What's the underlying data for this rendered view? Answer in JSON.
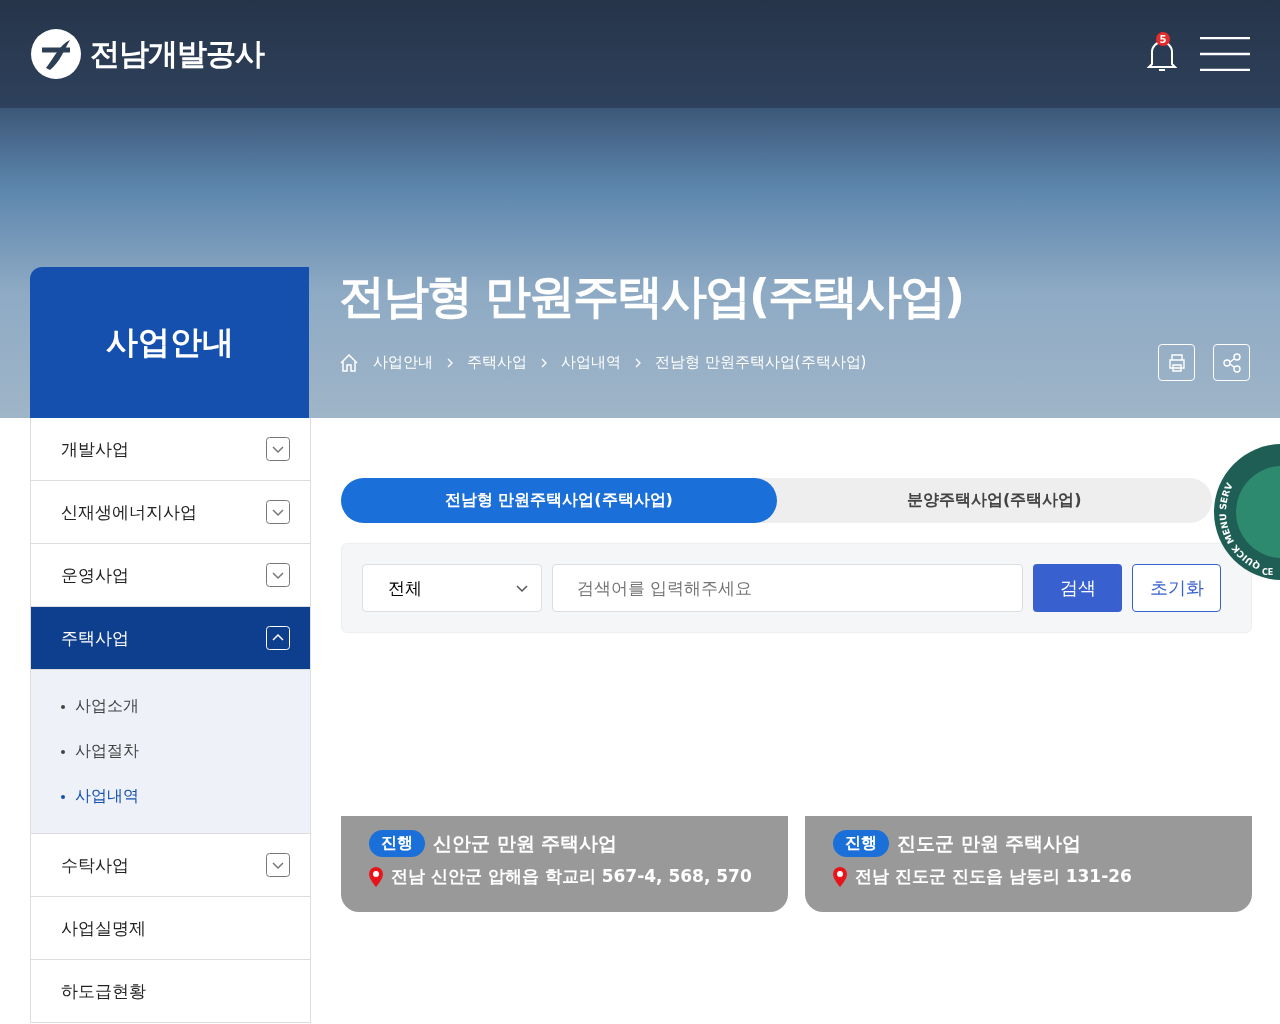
{
  "header": {
    "logo_text": "전남개발공사",
    "notification_count": "5"
  },
  "hero": {
    "title": "전남형 만원주택사업(주택사업)",
    "breadcrumb": [
      "사업안내",
      "주택사업",
      "사업내역",
      "전남형 만원주택사업(주택사업)"
    ]
  },
  "sidebar": {
    "title": "사업안내",
    "items": [
      {
        "label": "개발사업",
        "expanded": false,
        "selected": false
      },
      {
        "label": "신재생에너지사업",
        "expanded": false,
        "selected": false
      },
      {
        "label": "운영사업",
        "expanded": false,
        "selected": false
      },
      {
        "label": "주택사업",
        "expanded": true,
        "selected": true,
        "children": [
          {
            "label": "사업소개",
            "selected": false
          },
          {
            "label": "사업절차",
            "selected": false
          },
          {
            "label": "사업내역",
            "selected": true
          }
        ]
      },
      {
        "label": "수탁사업",
        "expanded": false,
        "selected": false
      },
      {
        "label": "사업실명제",
        "selected": false
      },
      {
        "label": "하도급현황",
        "selected": false
      }
    ]
  },
  "tabs": [
    {
      "label": "전남형 만원주택사업(주택사업)",
      "selected": true
    },
    {
      "label": "분양주택사업(주택사업)",
      "selected": false
    }
  ],
  "search": {
    "category": "전체",
    "placeholder": "검색어를 입력해주세요",
    "search_button": "검색",
    "reset_button": "초기화"
  },
  "projects": [
    {
      "status": "진행",
      "title": "신안군 만원 주택사업",
      "address": "전남 신안군 압해읍 학교리 567-4, 568, 570"
    },
    {
      "status": "진행",
      "title": "진도군 만원 주택사업",
      "address": "전남 진도군 진도읍 남동리 131-26"
    }
  ],
  "quick_menu": {
    "text_top": "QUICK MENU SERV",
    "text_bottom": "CE"
  }
}
